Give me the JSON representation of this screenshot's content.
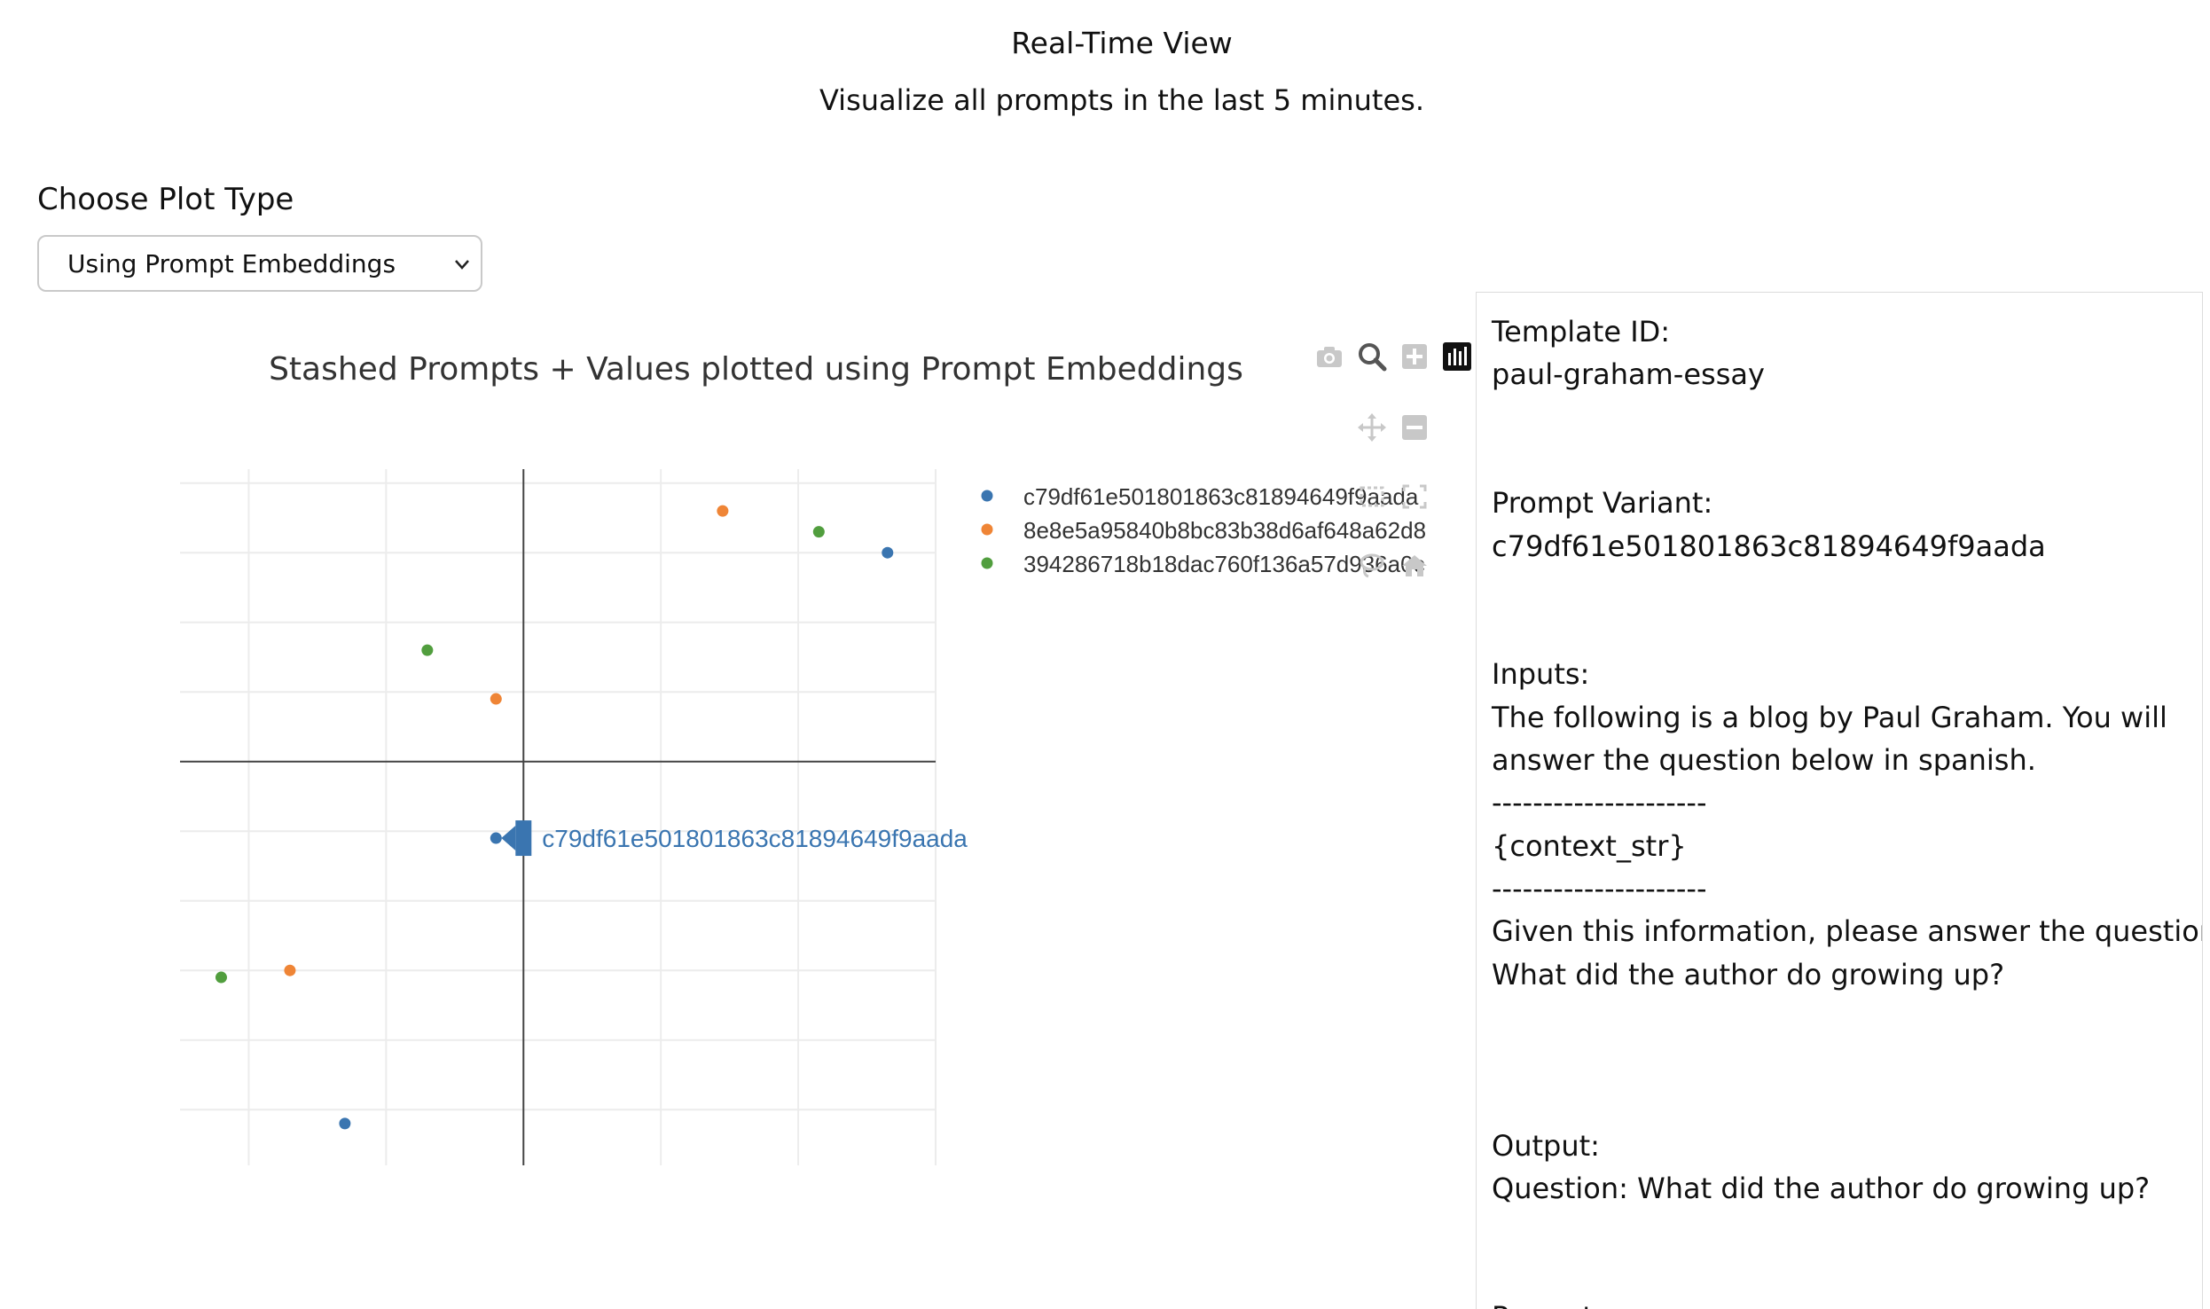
{
  "header": {
    "title": "Real-Time View",
    "subtitle": "Visualize all prompts in the last 5 minutes."
  },
  "plot_type": {
    "label": "Choose Plot Type",
    "selected": "Using Prompt Embeddings"
  },
  "modebar": {
    "icons": [
      "camera-icon",
      "zoom-icon",
      "zoom-in-icon",
      "bar-chart-icon",
      "pan-icon",
      "zoom-out-icon",
      "box-select-icon",
      "autoscale-icon",
      "lasso-icon",
      "home-icon"
    ]
  },
  "colors": {
    "blue": "#3a75b0",
    "orange": "#ef8536",
    "green": "#519e3e"
  },
  "chart_data": {
    "type": "scatter",
    "title": "Stashed Prompts + Values plotted using Prompt Embeddings",
    "xlabel": "",
    "ylabel": "",
    "grid": true,
    "legend_position": "top-right",
    "xlim": [
      -2.5,
      3.0
    ],
    "ylim": [
      -2.9,
      2.1
    ],
    "series": [
      {
        "name": "c79df61e501801863c81894649f9aada",
        "color": "#3a75b0",
        "points": [
          [
            2.65,
            1.5
          ],
          [
            -0.2,
            -0.55
          ],
          [
            -1.3,
            -2.6
          ]
        ]
      },
      {
        "name": "8e8e5a95840b8bc83b38d6af648a62d8",
        "color": "#ef8536",
        "points": [
          [
            1.45,
            1.8
          ],
          [
            -0.2,
            0.45
          ],
          [
            -1.7,
            -1.5
          ]
        ]
      },
      {
        "name": "394286718b18dac760f136a57d936a0c",
        "color": "#519e3e",
        "points": [
          [
            2.15,
            1.65
          ],
          [
            -0.7,
            0.8
          ],
          [
            -2.2,
            -1.55
          ]
        ]
      }
    ],
    "hover_label": "c79df61e501801863c81894649f9aada"
  },
  "details": {
    "lines": [
      "Template ID:",
      "paul-graham-essay",
      "",
      "",
      "Prompt Variant:",
      "c79df61e501801863c81894649f9aada",
      "",
      "",
      "Inputs:",
      "The following is a blog by Paul Graham. You will",
      "answer the question below in spanish.",
      "---------------------",
      "{context_str}",
      "---------------------",
      "Given this information, please answer the question:",
      "What did the author do growing up?",
      "",
      "",
      "",
      "Output:",
      "Question: What did the author do growing up?",
      "",
      "",
      "Prompt:"
    ]
  }
}
